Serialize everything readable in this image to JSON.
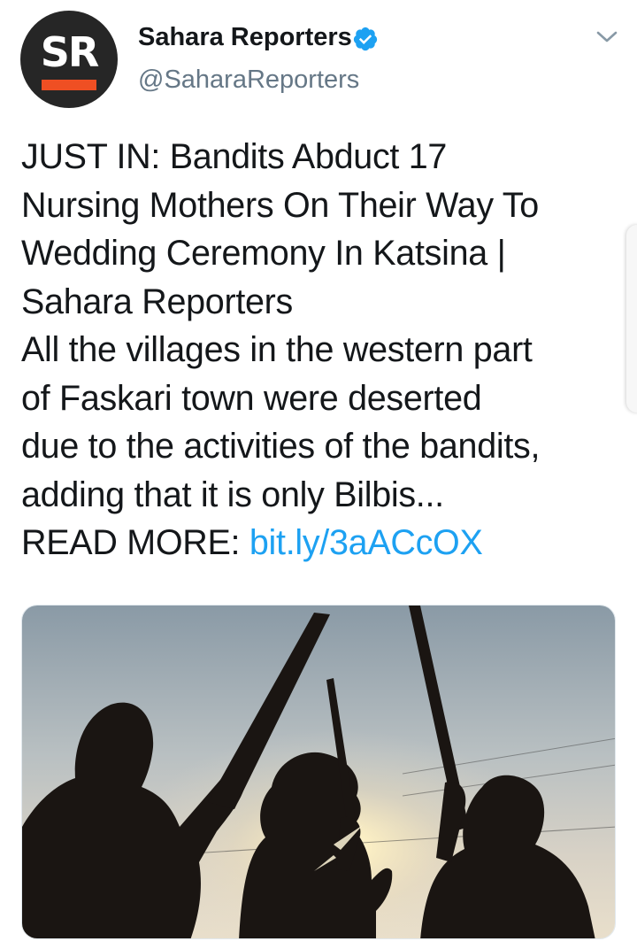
{
  "header": {
    "avatar_text": "SR",
    "display_name": "Sahara Reporters",
    "handle": "@SaharaReporters",
    "verified_icon": "verified-badge-icon",
    "menu_icon": "chevron-down-icon"
  },
  "tweet": {
    "lines": [
      "JUST IN: Bandits Abduct 17",
      "Nursing Mothers On Their Way To",
      "Wedding Ceremony In Katsina |",
      "Sahara Reporters",
      "All the villages in the western part",
      "of Faskari town were deserted",
      "due to the activities of the bandits,",
      "adding that it is only Bilbis..."
    ],
    "read_more_label": "READ MORE:",
    "link_text": "bit.ly/3aACcOX"
  },
  "colors": {
    "link": "#1da1f2",
    "verified": "#1da1f2",
    "avatar_bg": "#262626",
    "avatar_bar": "#ef4f23",
    "text": "#14171a",
    "muted": "#657786"
  },
  "media": {
    "image_subject": "silhouettes-of-armed-men-at-sunset"
  }
}
